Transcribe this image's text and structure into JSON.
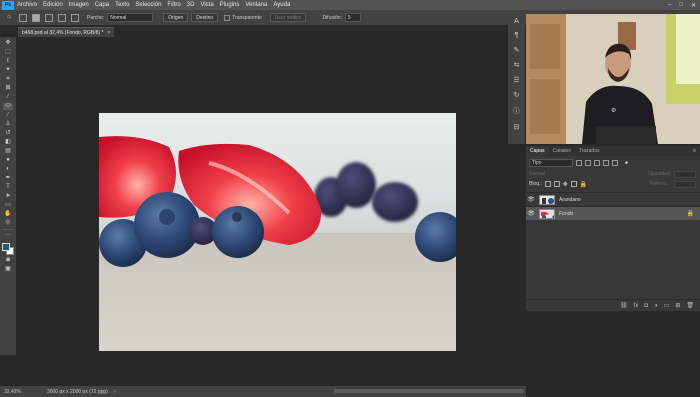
{
  "menubar": {
    "logo": "Ps",
    "items": [
      "Archivo",
      "Edición",
      "Imagen",
      "Capa",
      "Texto",
      "Selección",
      "Filtro",
      "3D",
      "Vista",
      "Plugins",
      "Ventana",
      "Ayuda"
    ],
    "window_controls": [
      "–",
      "□",
      "✕"
    ]
  },
  "options": {
    "patch_label": "Parche:",
    "patch_mode": "Normal",
    "origin_button": "Origen",
    "destination_button": "Destino",
    "transparent_label": "Transparente",
    "use_pattern_button": "Usar motivo",
    "diffusion_label": "Difusión:",
    "diffusion_value": "5"
  },
  "document": {
    "tab_title": "b468.psd al 32,4% (Fondo, RGB/8) *",
    "close": "×"
  },
  "status": {
    "zoom": "32,42%",
    "dimensions": "3000 px x 2000 px (72 ppp)",
    "arrow": "›"
  },
  "layers_panel": {
    "tabs": [
      "Capas",
      "Canales",
      "Trazados"
    ],
    "active_tab": 0,
    "kind_filter": "Tipo",
    "blend_mode": "Normal",
    "opacity_label": "Opacidad:",
    "lock_label": "Bloq.:",
    "fill_label": "Relleno:",
    "layers": [
      {
        "name": "Arandano",
        "visible": true,
        "selected": false,
        "locked": false
      },
      {
        "name": "Fondo",
        "visible": true,
        "selected": true,
        "locked": true
      }
    ]
  },
  "colors": {
    "foreground": "#1b5f6e",
    "background": "#ffffff",
    "accent": "#2fa3f7"
  }
}
